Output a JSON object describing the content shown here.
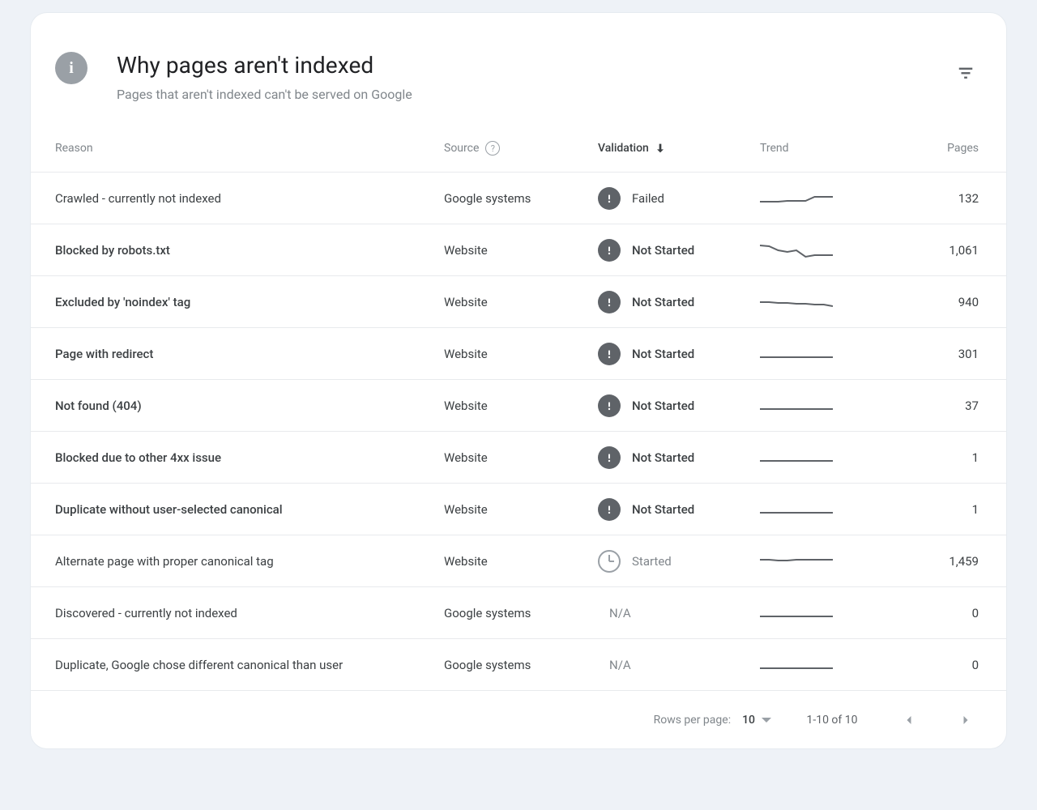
{
  "header": {
    "title": "Why pages aren't indexed",
    "subtitle": "Pages that aren't indexed can't be served on Google"
  },
  "columns": {
    "reason": "Reason",
    "source": "Source",
    "validation": "Validation",
    "trend": "Trend",
    "pages": "Pages"
  },
  "validation_labels": {
    "failed": "Failed",
    "not_started": "Not Started",
    "started": "Started",
    "na": "N/A"
  },
  "rows": [
    {
      "reason": "Crawled - currently not indexed",
      "bold": false,
      "source": "Google systems",
      "validation": "failed",
      "pages": "132",
      "trend": [
        18,
        18,
        18,
        17,
        17,
        17,
        12,
        12,
        12
      ]
    },
    {
      "reason": "Blocked by robots.txt",
      "bold": true,
      "source": "Website",
      "validation": "not_started",
      "pages": "1,061",
      "trend": [
        8,
        9,
        14,
        16,
        14,
        22,
        20,
        20,
        20
      ]
    },
    {
      "reason": "Excluded by 'noindex' tag",
      "bold": true,
      "source": "Website",
      "validation": "not_started",
      "pages": "940",
      "trend": [
        14,
        14,
        15,
        15,
        16,
        16,
        17,
        17,
        19
      ]
    },
    {
      "reason": "Page with redirect",
      "bold": true,
      "source": "Website",
      "validation": "not_started",
      "pages": "301",
      "trend": [
        18,
        18,
        18,
        18,
        18,
        18,
        18,
        18,
        18
      ]
    },
    {
      "reason": "Not found (404)",
      "bold": true,
      "source": "Website",
      "validation": "not_started",
      "pages": "37",
      "trend": [
        18,
        18,
        18,
        18,
        18,
        18,
        18,
        18,
        18
      ]
    },
    {
      "reason": "Blocked due to other 4xx issue",
      "bold": true,
      "source": "Website",
      "validation": "not_started",
      "pages": "1",
      "trend": [
        18,
        18,
        18,
        18,
        18,
        18,
        18,
        18,
        18
      ]
    },
    {
      "reason": "Duplicate without user-selected canonical",
      "bold": true,
      "source": "Website",
      "validation": "not_started",
      "pages": "1",
      "trend": [
        18,
        18,
        18,
        18,
        18,
        18,
        18,
        18,
        18
      ]
    },
    {
      "reason": "Alternate page with proper canonical tag",
      "bold": false,
      "source": "Website",
      "validation": "started",
      "pages": "1,459",
      "trend": [
        12,
        12,
        13,
        13,
        12,
        12,
        12,
        12,
        12
      ]
    },
    {
      "reason": "Discovered - currently not indexed",
      "bold": false,
      "source": "Google systems",
      "validation": "na",
      "pages": "0",
      "trend": [
        18,
        18,
        18,
        18,
        18,
        18,
        18,
        18,
        18
      ]
    },
    {
      "reason": "Duplicate, Google chose different canonical than user",
      "bold": false,
      "source": "Google systems",
      "validation": "na",
      "pages": "0",
      "trend": [
        18,
        18,
        18,
        18,
        18,
        18,
        18,
        18,
        18
      ]
    }
  ],
  "footer": {
    "rows_per_page_label": "Rows per page:",
    "rows_per_page_value": "10",
    "range": "1-10 of 10"
  }
}
